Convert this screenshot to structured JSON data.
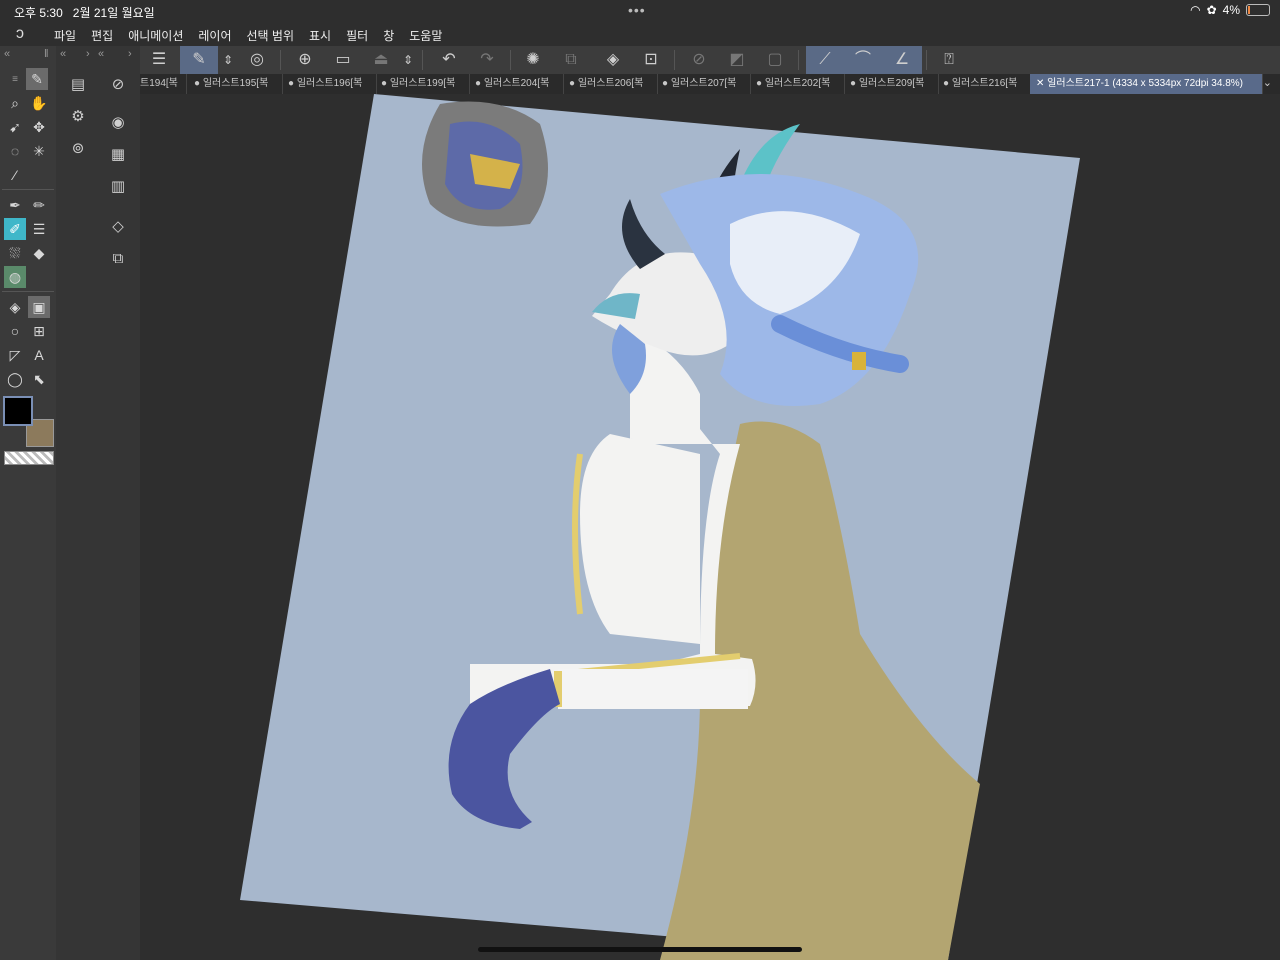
{
  "status": {
    "time": "오후 5:30",
    "date": "2월 21일 월요일",
    "battery": "4%"
  },
  "menu": [
    "파일",
    "편집",
    "애니메이션",
    "레이어",
    "선택 범위",
    "표시",
    "필터",
    "창",
    "도움말"
  ],
  "tabs": [
    "트194[복",
    "● 일러스트195[복",
    "● 일러스트196[복",
    "● 일러스트199[복",
    "● 일러스트204[복",
    "● 일러스트206[복",
    "● 일러스트207[복",
    "● 일러스트202[복",
    "● 일러스트209[복",
    "● 일러스트216[복",
    "일러스트217-1 (4334 x 5334px 72dpi 34.8%)"
  ],
  "colors": {
    "main": "#000000",
    "sub": "#8c7a5c",
    "canvas_bg": "#a7b7cc",
    "cape": "#b3a571",
    "accent": "#5a6a86"
  },
  "icons": {
    "app_logo": "clip-studio-logo-icon",
    "wifi": "wifi-icon",
    "battery": "battery-icon"
  }
}
